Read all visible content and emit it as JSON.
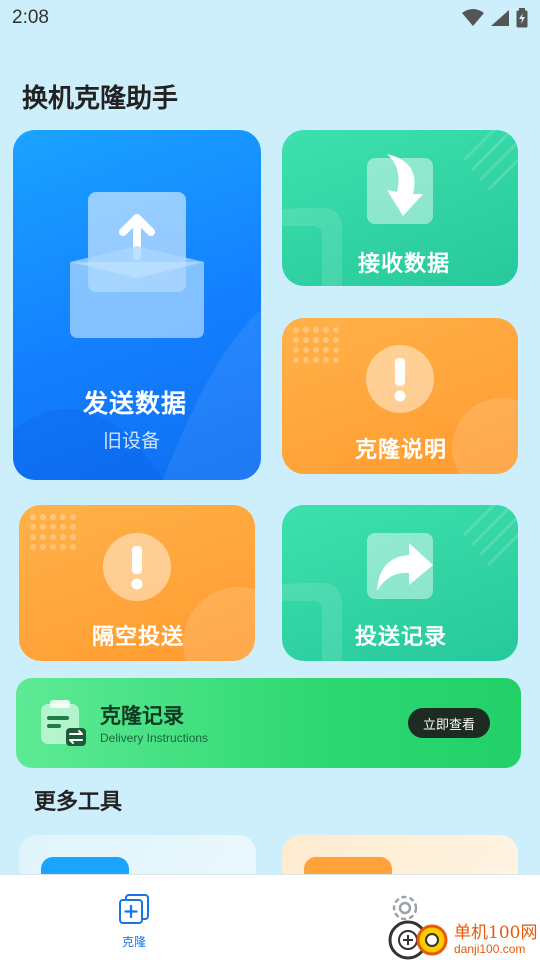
{
  "status_bar": {
    "time": "2:08"
  },
  "app": {
    "title": "换机克隆助手"
  },
  "cards": {
    "send": {
      "label": "发送数据",
      "sublabel": "旧设备"
    },
    "receive": {
      "label": "接收数据"
    },
    "guide": {
      "label": "克隆说明"
    },
    "airdrop": {
      "label": "隔空投送"
    },
    "history": {
      "label": "投送记录"
    }
  },
  "banner": {
    "title": "克隆记录",
    "subtitle": "Delivery Instructions",
    "button": "立即查看"
  },
  "more_tools": {
    "title": "更多工具"
  },
  "bottom_nav": {
    "items": [
      {
        "label": "克隆",
        "icon": "clone-icon",
        "active": true
      },
      {
        "label": "",
        "icon": "gear-icon",
        "active": false
      }
    ]
  },
  "watermark": {
    "line1": "单机100网",
    "line2": "danji100.com"
  },
  "colors": {
    "background": "#cdeefb",
    "blue": "#1480ff",
    "green": "#27c99c",
    "orange": "#ff9a2e",
    "banner_green": "#2ed872",
    "nav_active": "#1a73e8"
  }
}
